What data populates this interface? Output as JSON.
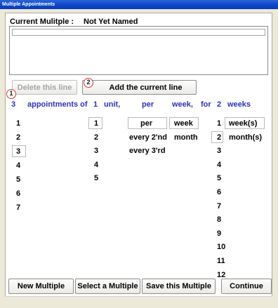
{
  "window": {
    "title": "Multiple Appointments"
  },
  "header": {
    "label": "Current Mulitple :",
    "value": "Not Yet Named"
  },
  "buttons": {
    "delete_line": "Delete this line",
    "add_line": "Add the current line",
    "new_multiple": "New Multiple",
    "select_multiple": "Select a Multiple",
    "save_multiple": "Save this Multiple",
    "continue": "Continue"
  },
  "badges": {
    "one": "1",
    "two": "2"
  },
  "summary": {
    "count": "3",
    "appointments_of": "appointments of",
    "units_value": "1",
    "unit_word": "unit,",
    "per_word": "per",
    "period_word": "week,",
    "for_word": "for",
    "duration_value": "2",
    "duration_unit": "weeks"
  },
  "columns": {
    "appointments": [
      "1",
      "2",
      "3",
      "4",
      "5",
      "6",
      "7"
    ],
    "appointments_selected_index": 2,
    "units": [
      "1",
      "2",
      "3",
      "4",
      "5"
    ],
    "units_selected_index": 0,
    "per_options": [
      "per",
      "every 2'nd",
      "every 3'rd"
    ],
    "per_selected_index": 0,
    "period_options": [
      "week",
      "month"
    ],
    "period_selected_index": 0,
    "durations": [
      "1",
      "2",
      "3",
      "4",
      "5",
      "6",
      "7",
      "8",
      "9",
      "10",
      "11",
      "12"
    ],
    "duration_selected_index": 1,
    "duration_units": [
      "week(s)",
      "month(s)"
    ],
    "duration_unit_selected_index": 0
  },
  "colors": {
    "accent_blue": "#2a32b8",
    "badge_red": "#d23b2a",
    "title_blue": "#0c45c9"
  }
}
